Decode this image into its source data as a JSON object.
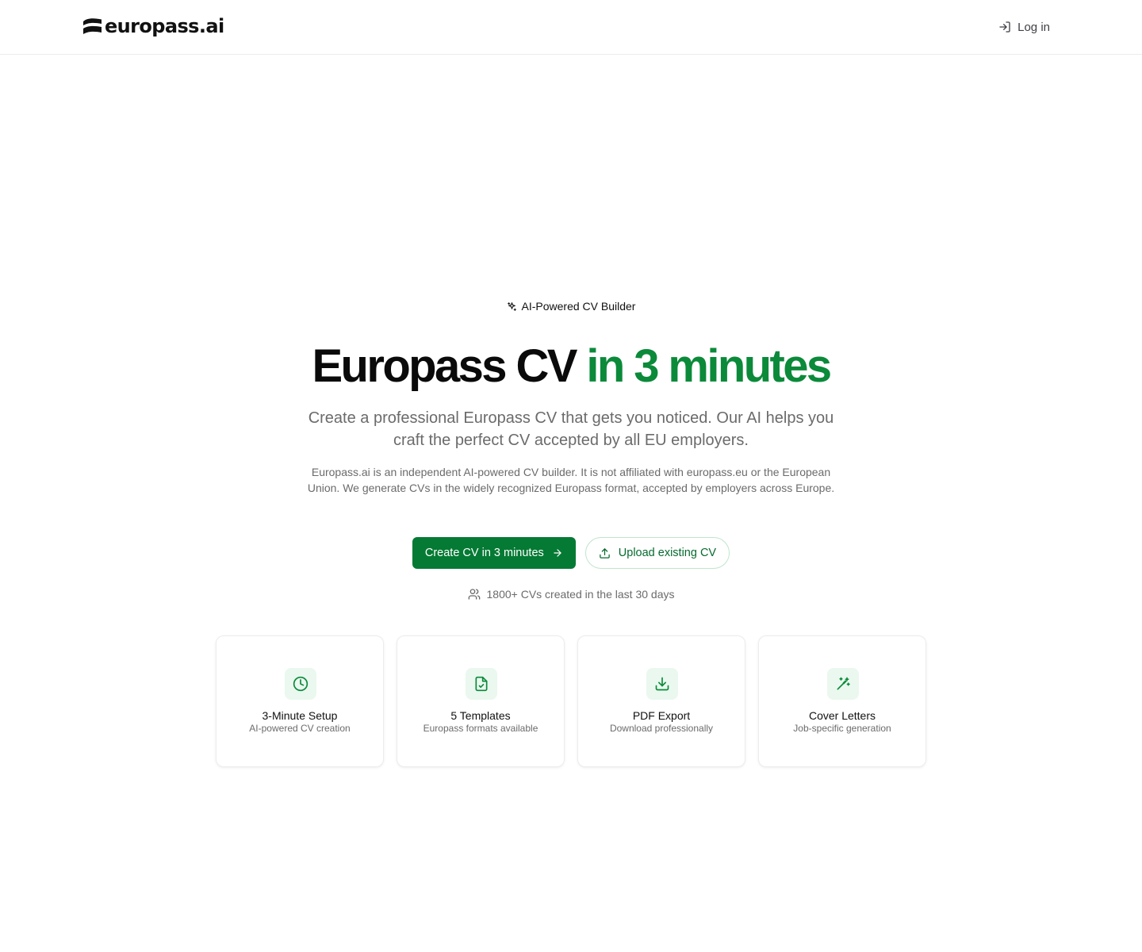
{
  "header": {
    "logo_text": "europass.ai",
    "login_label": "Log in"
  },
  "hero": {
    "badge": "AI-Powered CV Builder",
    "title_main": "Europass CV",
    "title_accent": "in 3 minutes",
    "subtitle": "Create a professional Europass CV that gets you noticed. Our AI helps you craft the perfect CV accepted by all EU employers.",
    "disclaimer": "Europass.ai is an independent AI-powered CV builder. It is not affiliated with europass.eu or the European Union. We generate CVs in the widely recognized Europass format, accepted by employers across Europe.",
    "primary_cta": "Create CV in 3 minutes",
    "secondary_cta": "Upload existing CV",
    "social_proof": "1800+ CVs created in the last 30 days"
  },
  "features": [
    {
      "icon": "clock-icon",
      "title": "3-Minute Setup",
      "description": "AI-powered CV creation"
    },
    {
      "icon": "file-check-icon",
      "title": "5 Templates",
      "description": "Europass formats available"
    },
    {
      "icon": "download-icon",
      "title": "PDF Export",
      "description": "Download professionally"
    },
    {
      "icon": "magic-wand-icon",
      "title": "Cover Letters",
      "description": "Job-specific generation"
    }
  ],
  "colors": {
    "accent_green": "#0b8a3a",
    "button_green": "#057a34",
    "icon_bg": "#eaf8ef"
  }
}
